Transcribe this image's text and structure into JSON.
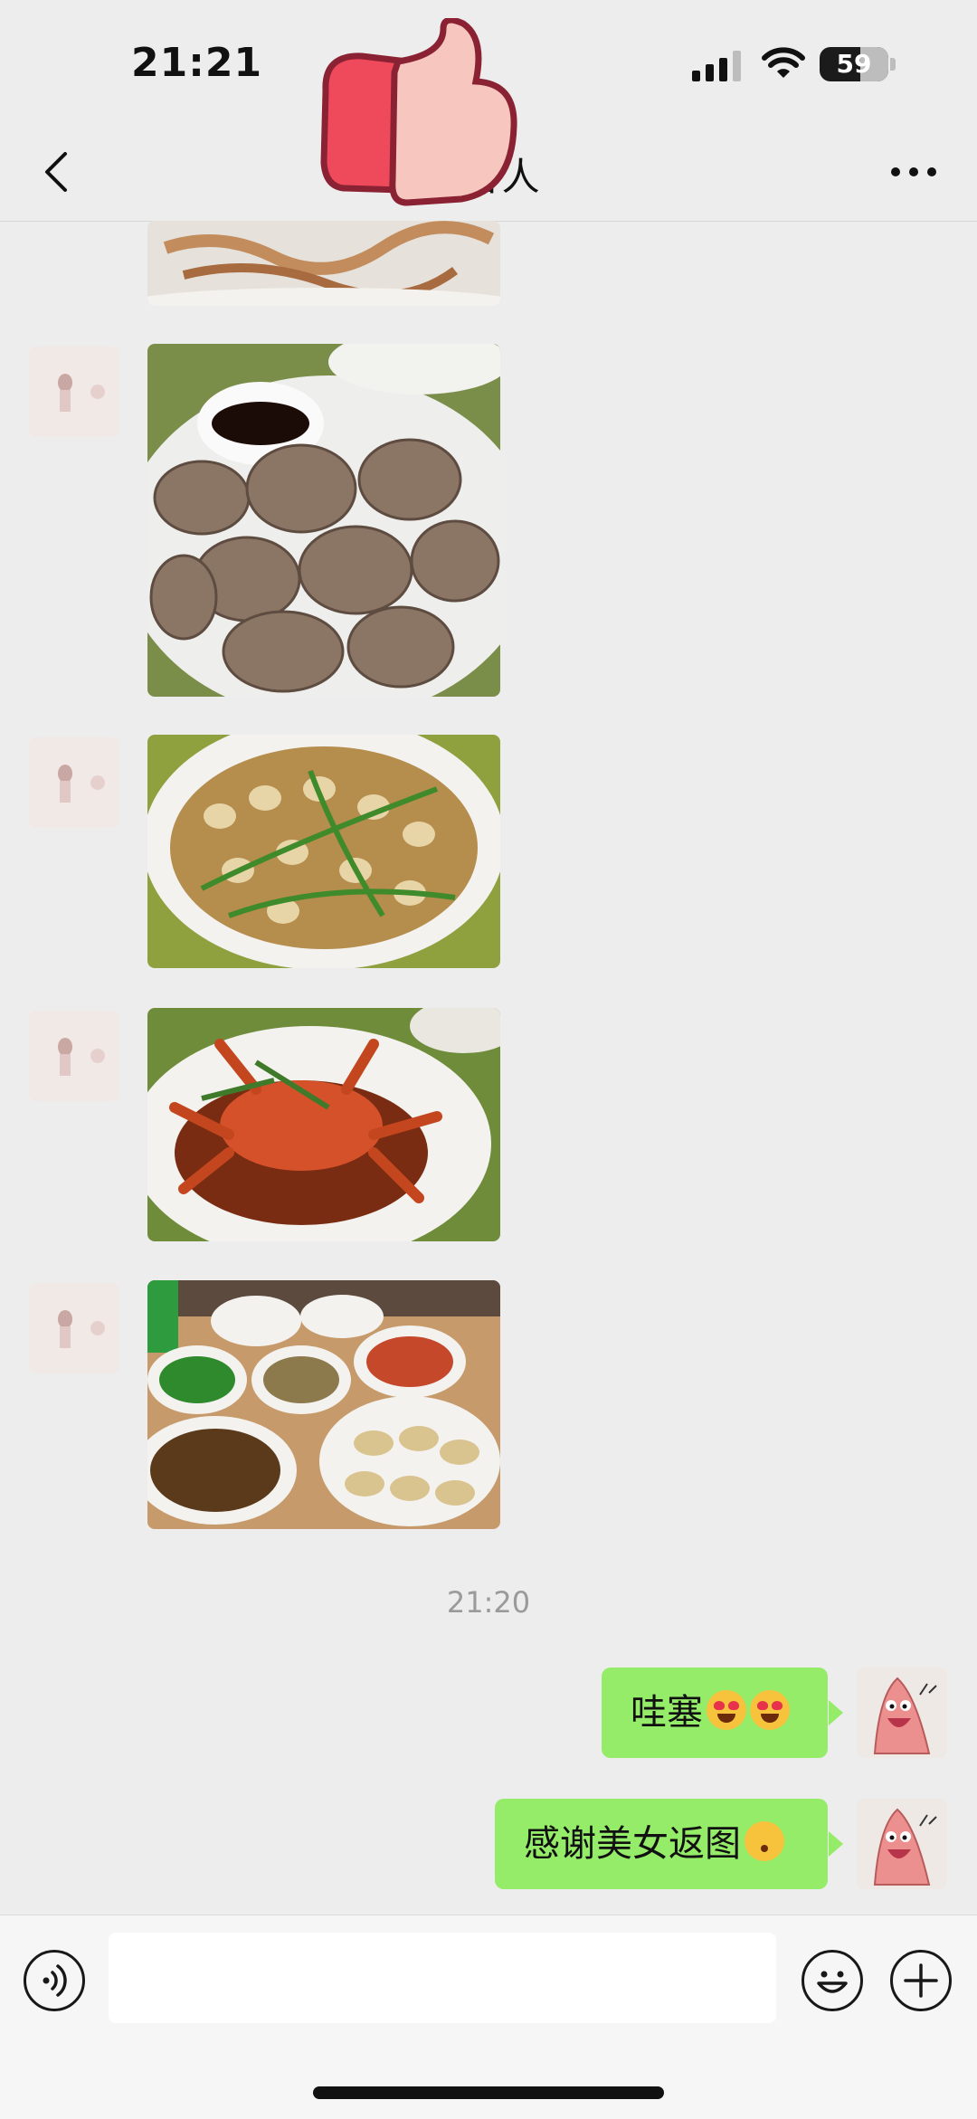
{
  "status": {
    "time": "21:21",
    "battery": "59",
    "battery_level": 0.59
  },
  "header": {
    "title": "C客人",
    "back_icon": "chevron-left-icon",
    "more_icon": "more-icon"
  },
  "messages": {
    "timestamp": "21:20",
    "sent": [
      {
        "text": "哇塞",
        "emoji": [
          "heart-eyes-emoji",
          "heart-eyes-emoji"
        ]
      },
      {
        "text": "感谢美女返图",
        "emoji": [
          "kissing-emoji"
        ]
      }
    ]
  },
  "input": {
    "value": "",
    "placeholder": ""
  },
  "colors": {
    "bubble": "#95ec69",
    "background": "#ededed"
  }
}
